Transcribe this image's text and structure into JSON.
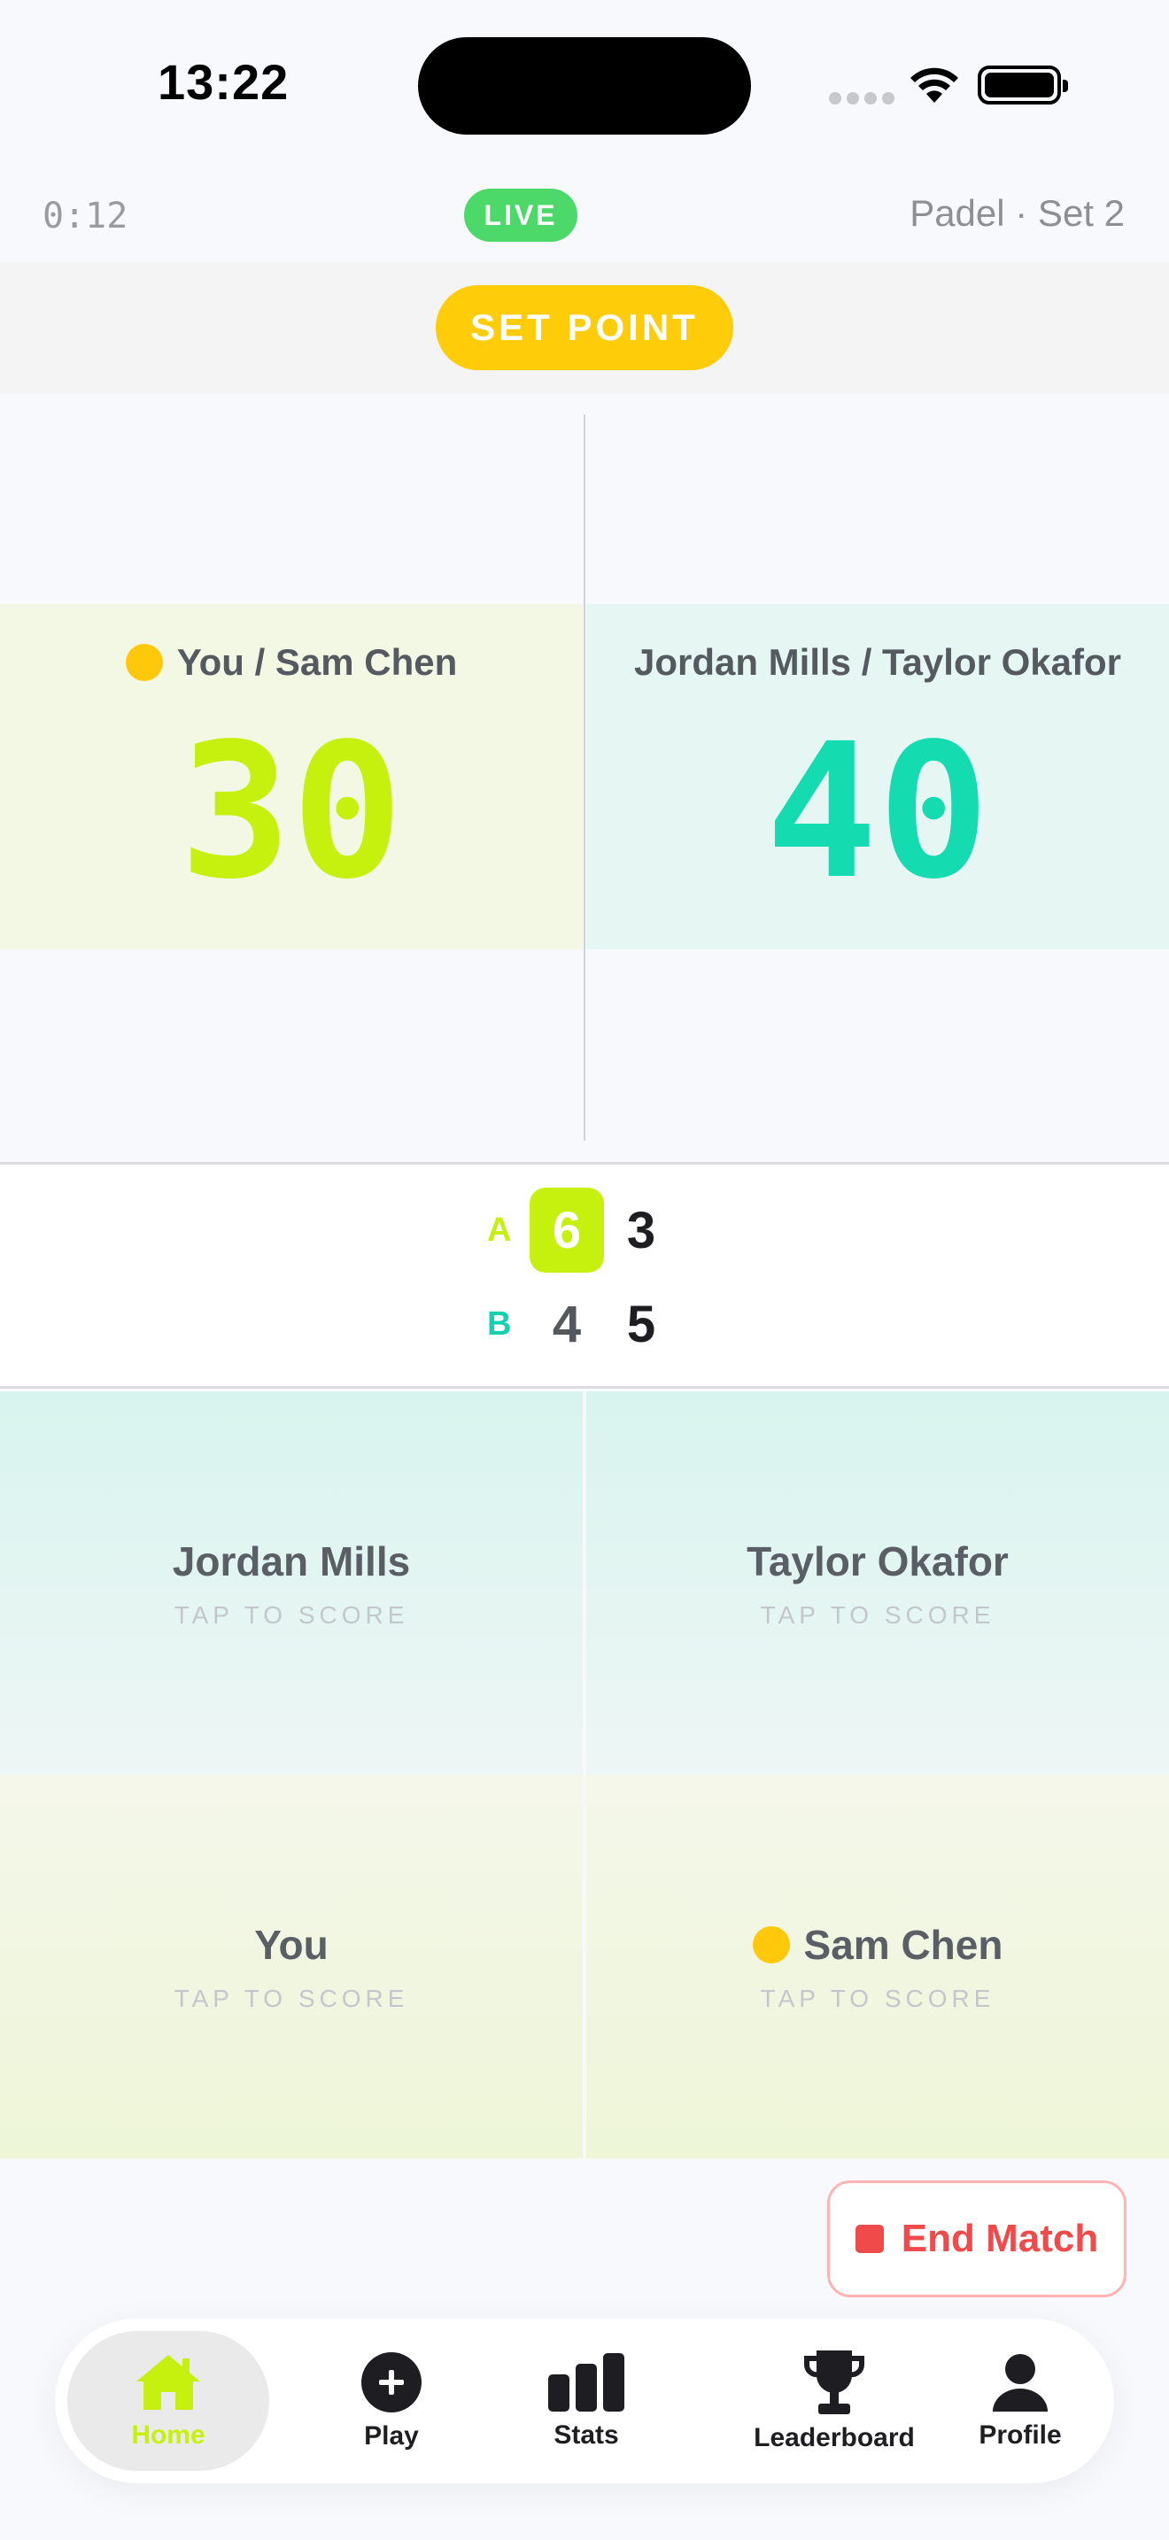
{
  "status_bar": {
    "time": "13:22"
  },
  "match": {
    "timer": "0:12",
    "live_label": "LIVE",
    "meta": "Padel · Set 2",
    "set_point_label": "SET POINT"
  },
  "teams": {
    "a": {
      "name": "You / Sam Chen",
      "points": "30"
    },
    "b": {
      "name": "Jordan Mills / Taylor Okafor",
      "points": "40"
    }
  },
  "sets": {
    "a": {
      "label": "A",
      "set1": "6",
      "set2": "3"
    },
    "b": {
      "label": "B",
      "set1": "4",
      "set2": "5"
    }
  },
  "players": {
    "top_left": {
      "name": "Jordan Mills",
      "hint": "TAP TO SCORE"
    },
    "top_right": {
      "name": "Taylor Okafor",
      "hint": "TAP TO SCORE"
    },
    "bottom_left": {
      "name": "You",
      "hint": "TAP TO SCORE"
    },
    "bottom_right": {
      "name": "Sam Chen",
      "hint": "TAP TO SCORE"
    }
  },
  "end_match_label": "End Match",
  "tabs": [
    {
      "label": "Home",
      "icon": "home-icon",
      "active": true
    },
    {
      "label": "Play",
      "icon": "plus-circle-icon"
    },
    {
      "label": "Stats",
      "icon": "bar-chart-icon"
    },
    {
      "label": "Leaderboard",
      "icon": "trophy-icon"
    },
    {
      "label": "Profile",
      "icon": "person-icon"
    }
  ],
  "colors": {
    "team_a_accent": "#c6f00e",
    "team_b_accent": "#15dbb0",
    "live": "#4cd96a",
    "set_point": "#ffcc0a",
    "serve": "#ffc80a",
    "end_match": "#f04a4a"
  }
}
